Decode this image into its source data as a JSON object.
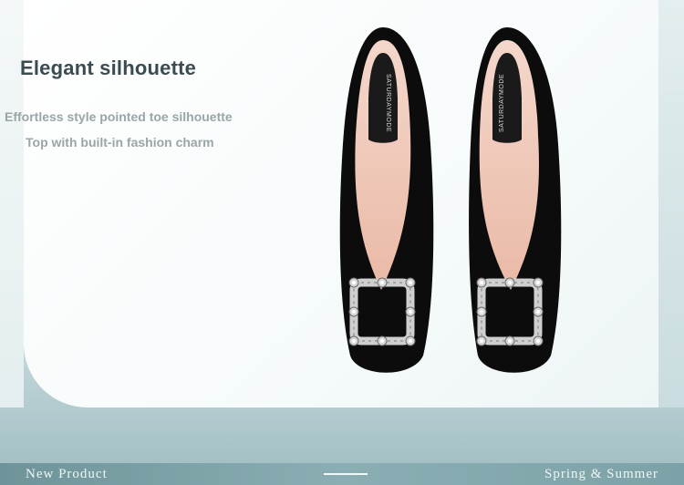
{
  "headline": "Elegant silhouette",
  "features": [
    "Effortless style pointed toe silhouette",
    "Top with built-in fashion charm"
  ],
  "product": {
    "insole_brand": "SATURDAYMODE",
    "image_alt": "black suede flats with crystal square buckle"
  },
  "footer": {
    "left_text": "New Product",
    "right_text": "Spring & Summer"
  },
  "colors": {
    "headline": "#3b4c50",
    "subtext": "#9aa5a8",
    "footer_bg": "#7fa4a9",
    "suede": "#0c0c0c",
    "lining": "#f1cbbd"
  }
}
